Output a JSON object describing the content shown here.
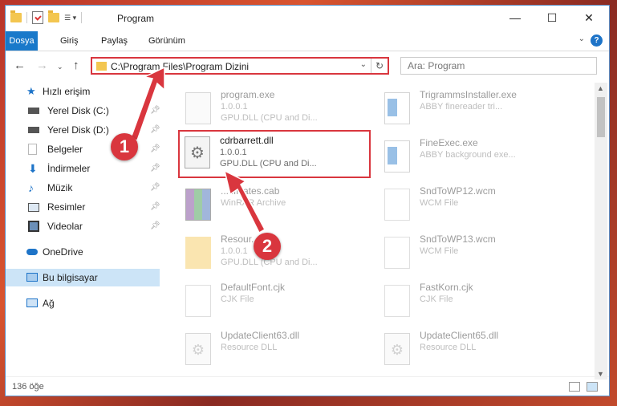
{
  "window": {
    "title": "Program",
    "controls": {
      "minimize": "—",
      "maximize": "☐",
      "close": "✕"
    }
  },
  "ribbon": {
    "tabs": [
      "Dosya",
      "Giriş",
      "Paylaş",
      "Görünüm"
    ],
    "help": "?"
  },
  "address": {
    "path": "C:\\Program Files\\Program Dizini",
    "search_placeholder": "Ara: Program"
  },
  "sidebar": {
    "quick_access": "Hızlı erişim",
    "items": [
      {
        "label": "Yerel Disk (C:)",
        "icon": "drive-icon"
      },
      {
        "label": "Yerel Disk (D:)",
        "icon": "drive-icon"
      },
      {
        "label": "Belgeler",
        "icon": "documents-icon"
      },
      {
        "label": "İndirmeler",
        "icon": "downloads-icon"
      },
      {
        "label": "Müzik",
        "icon": "music-icon"
      },
      {
        "label": "Resimler",
        "icon": "pictures-icon"
      },
      {
        "label": "Videolar",
        "icon": "videos-icon"
      }
    ],
    "onedrive": "OneDrive",
    "this_pc": "Bu bilgisayar",
    "network": "Ağ"
  },
  "files": [
    {
      "name": "program.exe",
      "line2": "1.0.0.1",
      "line3": "GPU.DLL (CPU and Di...",
      "icon": "exe-icon"
    },
    {
      "name": "TrigrammsInstaller.exe",
      "line2": "ABBY finereader tri...",
      "line3": "",
      "icon": "app-window-icon"
    },
    {
      "name": "cdrbarrett.dll",
      "line2": "1.0.0.1",
      "line3": "GPU.DLL (CPU and Di...",
      "icon": "dll-gear-icon"
    },
    {
      "name": "FineExec.exe",
      "line2": "ABBY background exe...",
      "line3": "",
      "icon": "app-window-icon"
    },
    {
      "name": "...tificates.cab",
      "line2": "WinRAR Archive",
      "line3": "",
      "icon": "archive-icon"
    },
    {
      "name": "SndToWP12.wcm",
      "line2": "WCM File",
      "line3": "",
      "icon": "document-icon"
    },
    {
      "name": "Resour...",
      "line2": "1.0.0.1",
      "line3": "GPU.DLL (CPU and Di...",
      "icon": "folder-icon"
    },
    {
      "name": "SndToWP13.wcm",
      "line2": "WCM File",
      "line3": "",
      "icon": "document-icon"
    },
    {
      "name": "DefaultFont.cjk",
      "line2": "CJK File",
      "line3": "",
      "icon": "document-icon"
    },
    {
      "name": "FastKorn.cjk",
      "line2": "CJK File",
      "line3": "",
      "icon": "document-icon"
    },
    {
      "name": "UpdateClient63.dll",
      "line2": "Resource DLL",
      "line3": "",
      "icon": "dll-gear-icon"
    },
    {
      "name": "UpdateClient65.dll",
      "line2": "Resource DLL",
      "line3": "",
      "icon": "dll-gear-icon"
    }
  ],
  "status": {
    "count": "136 öğe"
  },
  "annotations": {
    "step1": "1",
    "step2": "2",
    "color": "#d9363e"
  }
}
